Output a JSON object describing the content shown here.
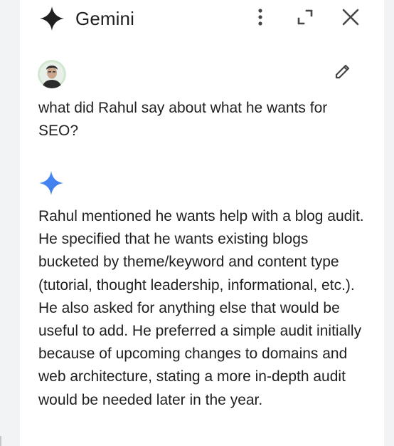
{
  "header": {
    "title": "Gemini",
    "icons": {
      "logo": "gemini-sparkle-icon",
      "more": "more-vert-icon",
      "expand": "expand-icon",
      "close": "close-icon"
    }
  },
  "conversation": {
    "user": {
      "avatar_icon": "user-avatar",
      "edit_icon": "pencil-icon",
      "query": "what did Rahul say about what he wants for SEO?"
    },
    "response": {
      "icon": "gemini-sparkle-icon",
      "text": "Rahul mentioned he wants help with a blog audit. He specified that he wants existing blogs bucketed by theme/keyword and content type (tutorial, thought leadership, informational, etc.). He also asked for anything else that would be useful to add. He preferred a simple audit initially because of upcoming changes to domains and web architecture, stating a more in-depth audit would be needed later in the year."
    }
  },
  "colors": {
    "background": "#f1f3f4",
    "panel": "#ffffff",
    "text": "#1f1f1f",
    "icon": "#444746",
    "gemini_blue": "#4285f4"
  }
}
